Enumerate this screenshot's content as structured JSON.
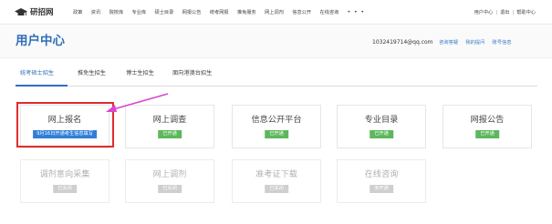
{
  "topbar": {
    "logo_text": "研招网",
    "nav": [
      "政策",
      "资讯",
      "院校库",
      "专业库",
      "硕士目录",
      "网报公告",
      "统考网报",
      "推免服务",
      "网上调剂",
      "信息公开",
      "在线咨询"
    ],
    "nav_more": "• • •",
    "user_center": "用户中心",
    "sep": "|",
    "logout": "退出",
    "help_center": "帮助中心"
  },
  "header": {
    "title": "用户中心",
    "email": "1032419714@qq.com",
    "links": [
      "咨询答疑",
      "我的提问",
      "账号信息"
    ]
  },
  "tabs": [
    "统考硕士招生",
    "推免生招生",
    "博士生招生",
    "面向港澳台招生"
  ],
  "cards": [
    {
      "title": "网上报名",
      "badge": "9月16日开通考生信息填写",
      "status": "highlight"
    },
    {
      "title": "网上调查",
      "badge": "已开通",
      "status": "open"
    },
    {
      "title": "信息公开平台",
      "badge": "已开通",
      "status": "open"
    },
    {
      "title": "专业目录",
      "badge": "已开通",
      "status": "open"
    },
    {
      "title": "网报公告",
      "badge": "已开通",
      "status": "open"
    },
    {
      "title": "调剂意向采集",
      "badge": "已关闭",
      "status": "closed"
    },
    {
      "title": "网上调剂",
      "badge": "已关闭",
      "status": "closed"
    },
    {
      "title": "准考证下载",
      "badge": "已关闭",
      "status": "closed"
    },
    {
      "title": "在线咨询",
      "badge": "未开通",
      "status": "closed"
    }
  ],
  "colors": {
    "brand": "#2f6fb8",
    "open": "#5cb85c",
    "closed": "#cfcfcf",
    "notice": "#2f7ed8",
    "highlight": "#e02c2c",
    "arrow": "#d946d0"
  }
}
